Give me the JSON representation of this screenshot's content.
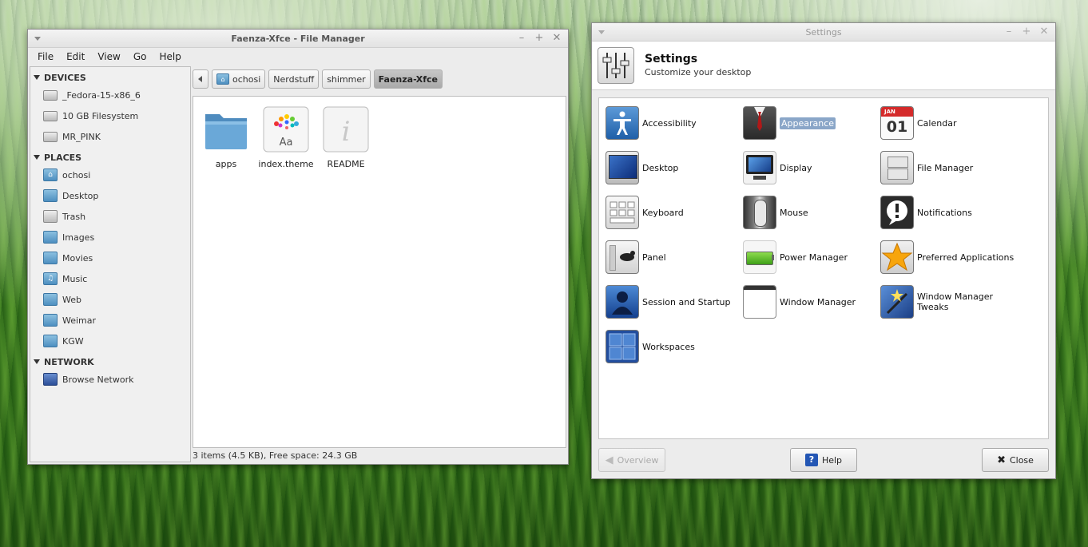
{
  "file_manager": {
    "title": "Faenza-Xfce - File Manager",
    "menu": [
      "File",
      "Edit",
      "View",
      "Go",
      "Help"
    ],
    "devices_header": "DEVICES",
    "devices": [
      "_Fedora-15-x86_6",
      "10 GB Filesystem",
      "MR_PINK"
    ],
    "places_header": "PLACES",
    "places": [
      "ochosi",
      "Desktop",
      "Trash",
      "Images",
      "Movies",
      "Music",
      "Web",
      "Weimar",
      "KGW"
    ],
    "network_header": "NETWORK",
    "network": [
      "Browse Network"
    ],
    "path": [
      "ochosi",
      "Nerdstuff",
      "shimmer",
      "Faenza-Xfce"
    ],
    "files": [
      "apps",
      "index.theme",
      "README"
    ],
    "status": "3 items (4.5 KB), Free space: 24.3 GB"
  },
  "settings": {
    "window_title": "Settings",
    "header_title": "Settings",
    "header_subtitle": "Customize your desktop",
    "items": [
      "Accessibility",
      "Appearance",
      "Calendar",
      "Desktop",
      "Display",
      "File Manager",
      "Keyboard",
      "Mouse",
      "Notifications",
      "Panel",
      "Power Manager",
      "Preferred Applications",
      "Session and Startup",
      "Window Manager",
      "Window Manager Tweaks",
      "Workspaces"
    ],
    "selected": "Appearance",
    "calendar_month": "JAN",
    "calendar_day": "01",
    "overview_label": "Overview",
    "help_label": "Help",
    "close_label": "Close"
  },
  "colors": {
    "folder": "#5b9bd0",
    "selection": "#8aa6c8",
    "window_bg": "#ececec"
  }
}
